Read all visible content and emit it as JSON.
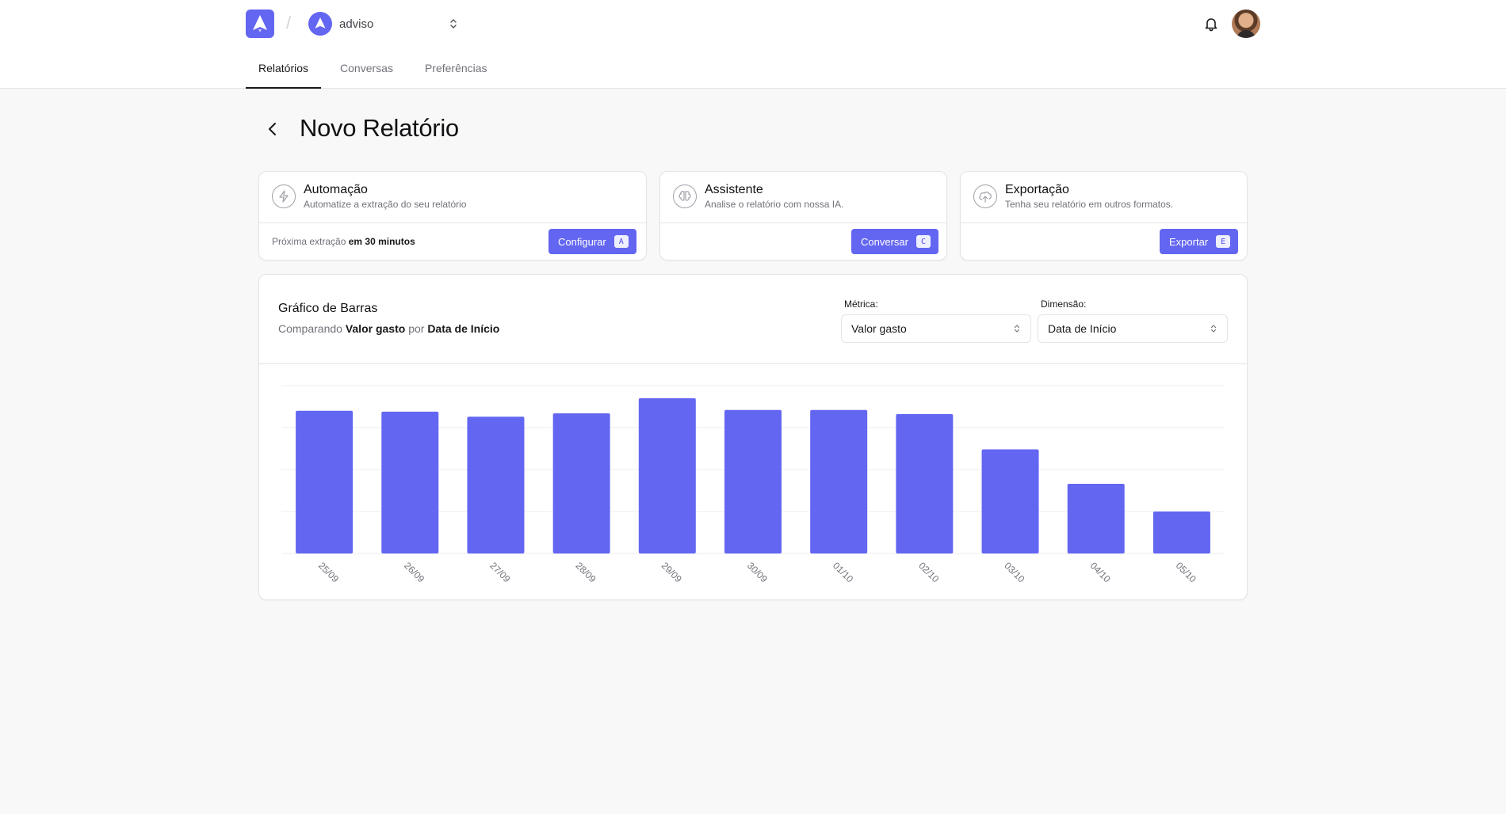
{
  "header": {
    "org_name": "adviso",
    "tabs": [
      {
        "label": "Relatórios",
        "active": true
      },
      {
        "label": "Conversas",
        "active": false
      },
      {
        "label": "Preferências",
        "active": false
      }
    ]
  },
  "page": {
    "title": "Novo Relatório"
  },
  "cards": {
    "automation": {
      "title": "Automação",
      "description": "Automatize a extração do seu relatório",
      "footer_prefix": "Próxima extração",
      "footer_value": "em 30 minutos",
      "button": "Configurar",
      "shortcut": "A"
    },
    "assistant": {
      "title": "Assistente",
      "description": "Analise o relatório com nossa IA.",
      "button": "Conversar",
      "shortcut": "C"
    },
    "export": {
      "title": "Exportação",
      "description": "Tenha seu relatório em outros formatos.",
      "button": "Exportar",
      "shortcut": "E"
    }
  },
  "chart_panel": {
    "title": "Gráfico de Barras",
    "subtitle_prefix": "Comparando",
    "metric_bold": "Valor gasto",
    "subtitle_mid": "por",
    "dimension_bold": "Data de Início",
    "metric_label": "Métrica:",
    "metric_value": "Valor gasto",
    "dimension_label": "Dimensão:",
    "dimension_value": "Data de Início"
  },
  "colors": {
    "accent": "#6366f1",
    "bar": "#6366f1",
    "grid": "#ececf0"
  },
  "chart_data": {
    "type": "bar",
    "categories": [
      "25/09",
      "26/09",
      "27/09",
      "28/09",
      "29/09",
      "30/09",
      "01/10",
      "02/10",
      "03/10",
      "04/10",
      "05/10"
    ],
    "values": [
      0.85,
      0.845,
      0.815,
      0.835,
      0.925,
      0.855,
      0.855,
      0.83,
      0.62,
      0.415,
      0.25
    ],
    "ylim": [
      0,
      1
    ],
    "grid": true,
    "title": "",
    "xlabel": "",
    "ylabel": ""
  }
}
